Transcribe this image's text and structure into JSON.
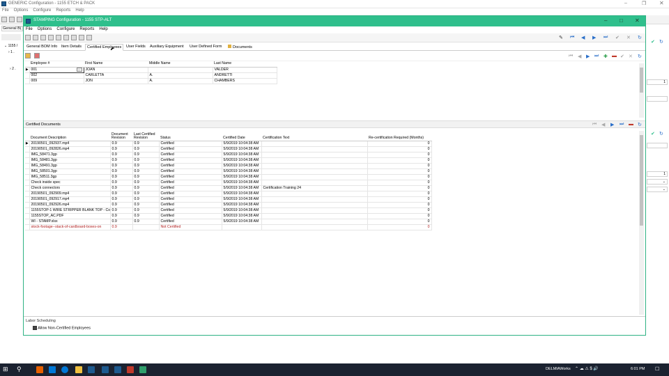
{
  "bg_window": {
    "title": "GENERIC Configuration - 1155 ETCH & PACK",
    "menu": [
      "File",
      "Options",
      "Configure",
      "Reports",
      "Help"
    ],
    "left_tab": "General B(",
    "tree_items": [
      "1155 /",
      "1 .",
      "2 ."
    ],
    "right_values": [
      "1",
      "1"
    ]
  },
  "dialog": {
    "title": "STAMPING Configuration - 1155 STP-ALT",
    "menu": [
      "File",
      "Options",
      "Configure",
      "Reports",
      "Help"
    ],
    "tabs": [
      "General BOM Info",
      "Item Details",
      "Certified Employees",
      "User Fields",
      "Auxiliary Equipment",
      "User Defined Form",
      "Documents"
    ],
    "employees": {
      "columns": [
        "Employee #",
        "First Name",
        "Middle Name",
        "Last Name"
      ],
      "rows": [
        [
          "001",
          "JOAN",
          "",
          "VALDER"
        ],
        [
          "002",
          "CARLETTA",
          "A.",
          "ANDRETTI"
        ],
        [
          "009",
          "JON",
          "A.",
          "CHAMBERS"
        ]
      ]
    },
    "certified_docs": {
      "title": "Certified Documents",
      "columns": [
        "Document Description",
        "Document Revision",
        "Last Certified Revision",
        "Status",
        "Certified Date",
        "Certification Text",
        "Re-certification Required (Months)"
      ],
      "rows": [
        [
          "20190501_092937.mp4",
          "0.9",
          "0.9",
          "Certified",
          "5/9/2019 10:04:38 AM",
          "",
          "0"
        ],
        [
          "20190501_092826.mp4",
          "0.9",
          "0.9",
          "Certified",
          "5/9/2019 10:04:38 AM",
          "",
          "0"
        ],
        [
          "IMG_58471.3gp",
          "0.9",
          "0.9",
          "Certified",
          "5/9/2019 10:04:38 AM",
          "",
          "0"
        ],
        [
          "IMG_58481.3gp",
          "0.9",
          "0.9",
          "Certified",
          "5/9/2019 10:04:38 AM",
          "",
          "0"
        ],
        [
          "IMG_58491.3gp",
          "0.9",
          "0.9",
          "Certified",
          "5/9/2019 10:04:38 AM",
          "",
          "0"
        ],
        [
          "IMG_58501.3gp",
          "0.9",
          "0.9",
          "Certified",
          "5/9/2019 10:04:38 AM",
          "",
          "0"
        ],
        [
          "IMG_58511.3gp",
          "0.9",
          "0.9",
          "Certified",
          "5/9/2019 10:04:38 AM",
          "",
          "0"
        ],
        [
          "Check inside spec",
          "0.9",
          "0.9",
          "Certified",
          "5/9/2019 10:04:38 AM",
          "",
          "0"
        ],
        [
          "Check connectors",
          "0.9",
          "0.9",
          "Certified",
          "5/9/2019 10:04:38 AM",
          "Certification Training 24",
          "0"
        ],
        [
          "20190501_092909.mp4",
          "0.9",
          "0.9",
          "Certified",
          "5/9/2019 10:04:38 AM",
          "",
          "0"
        ],
        [
          "20190501_092917.mp4",
          "0.9",
          "0.9",
          "Certified",
          "5/9/2019 10:04:38 AM",
          "",
          "0"
        ],
        [
          "20190501_092926.mp4",
          "0.9",
          "0.9",
          "Certified",
          "5/9/2019 10:04:38 AM",
          "",
          "0"
        ],
        [
          "1155STOP-1 WIRE STRIPPER BLANK TOP - Com",
          "0.9",
          "0.9",
          "Certified",
          "5/9/2019 10:04:38 AM",
          "",
          "0"
        ],
        [
          "1155STOP_AC.PDF",
          "0.9",
          "0.9",
          "Certified",
          "5/9/2019 10:04:38 AM",
          "",
          "0"
        ],
        [
          "WI - STAMP.xlsx",
          "0.9",
          "0.9",
          "Certified",
          "5/9/2019 10:04:38 AM",
          "",
          "0"
        ],
        [
          "stock-footage--stack-of-cardboard-boxes-on",
          "0.9",
          "",
          "Not Certified",
          "",
          "",
          "0"
        ]
      ]
    },
    "labor": {
      "title": "Labor Scheduling",
      "allow_label": "Allow Non-Certified Employees"
    }
  },
  "taskbar": {
    "app_label": "DELMIAWorks",
    "time": "6:01 PM"
  },
  "colors": {
    "titlebar": "#2fbf8c",
    "not_certified": "#b22222",
    "taskbar": "#1b2230"
  }
}
